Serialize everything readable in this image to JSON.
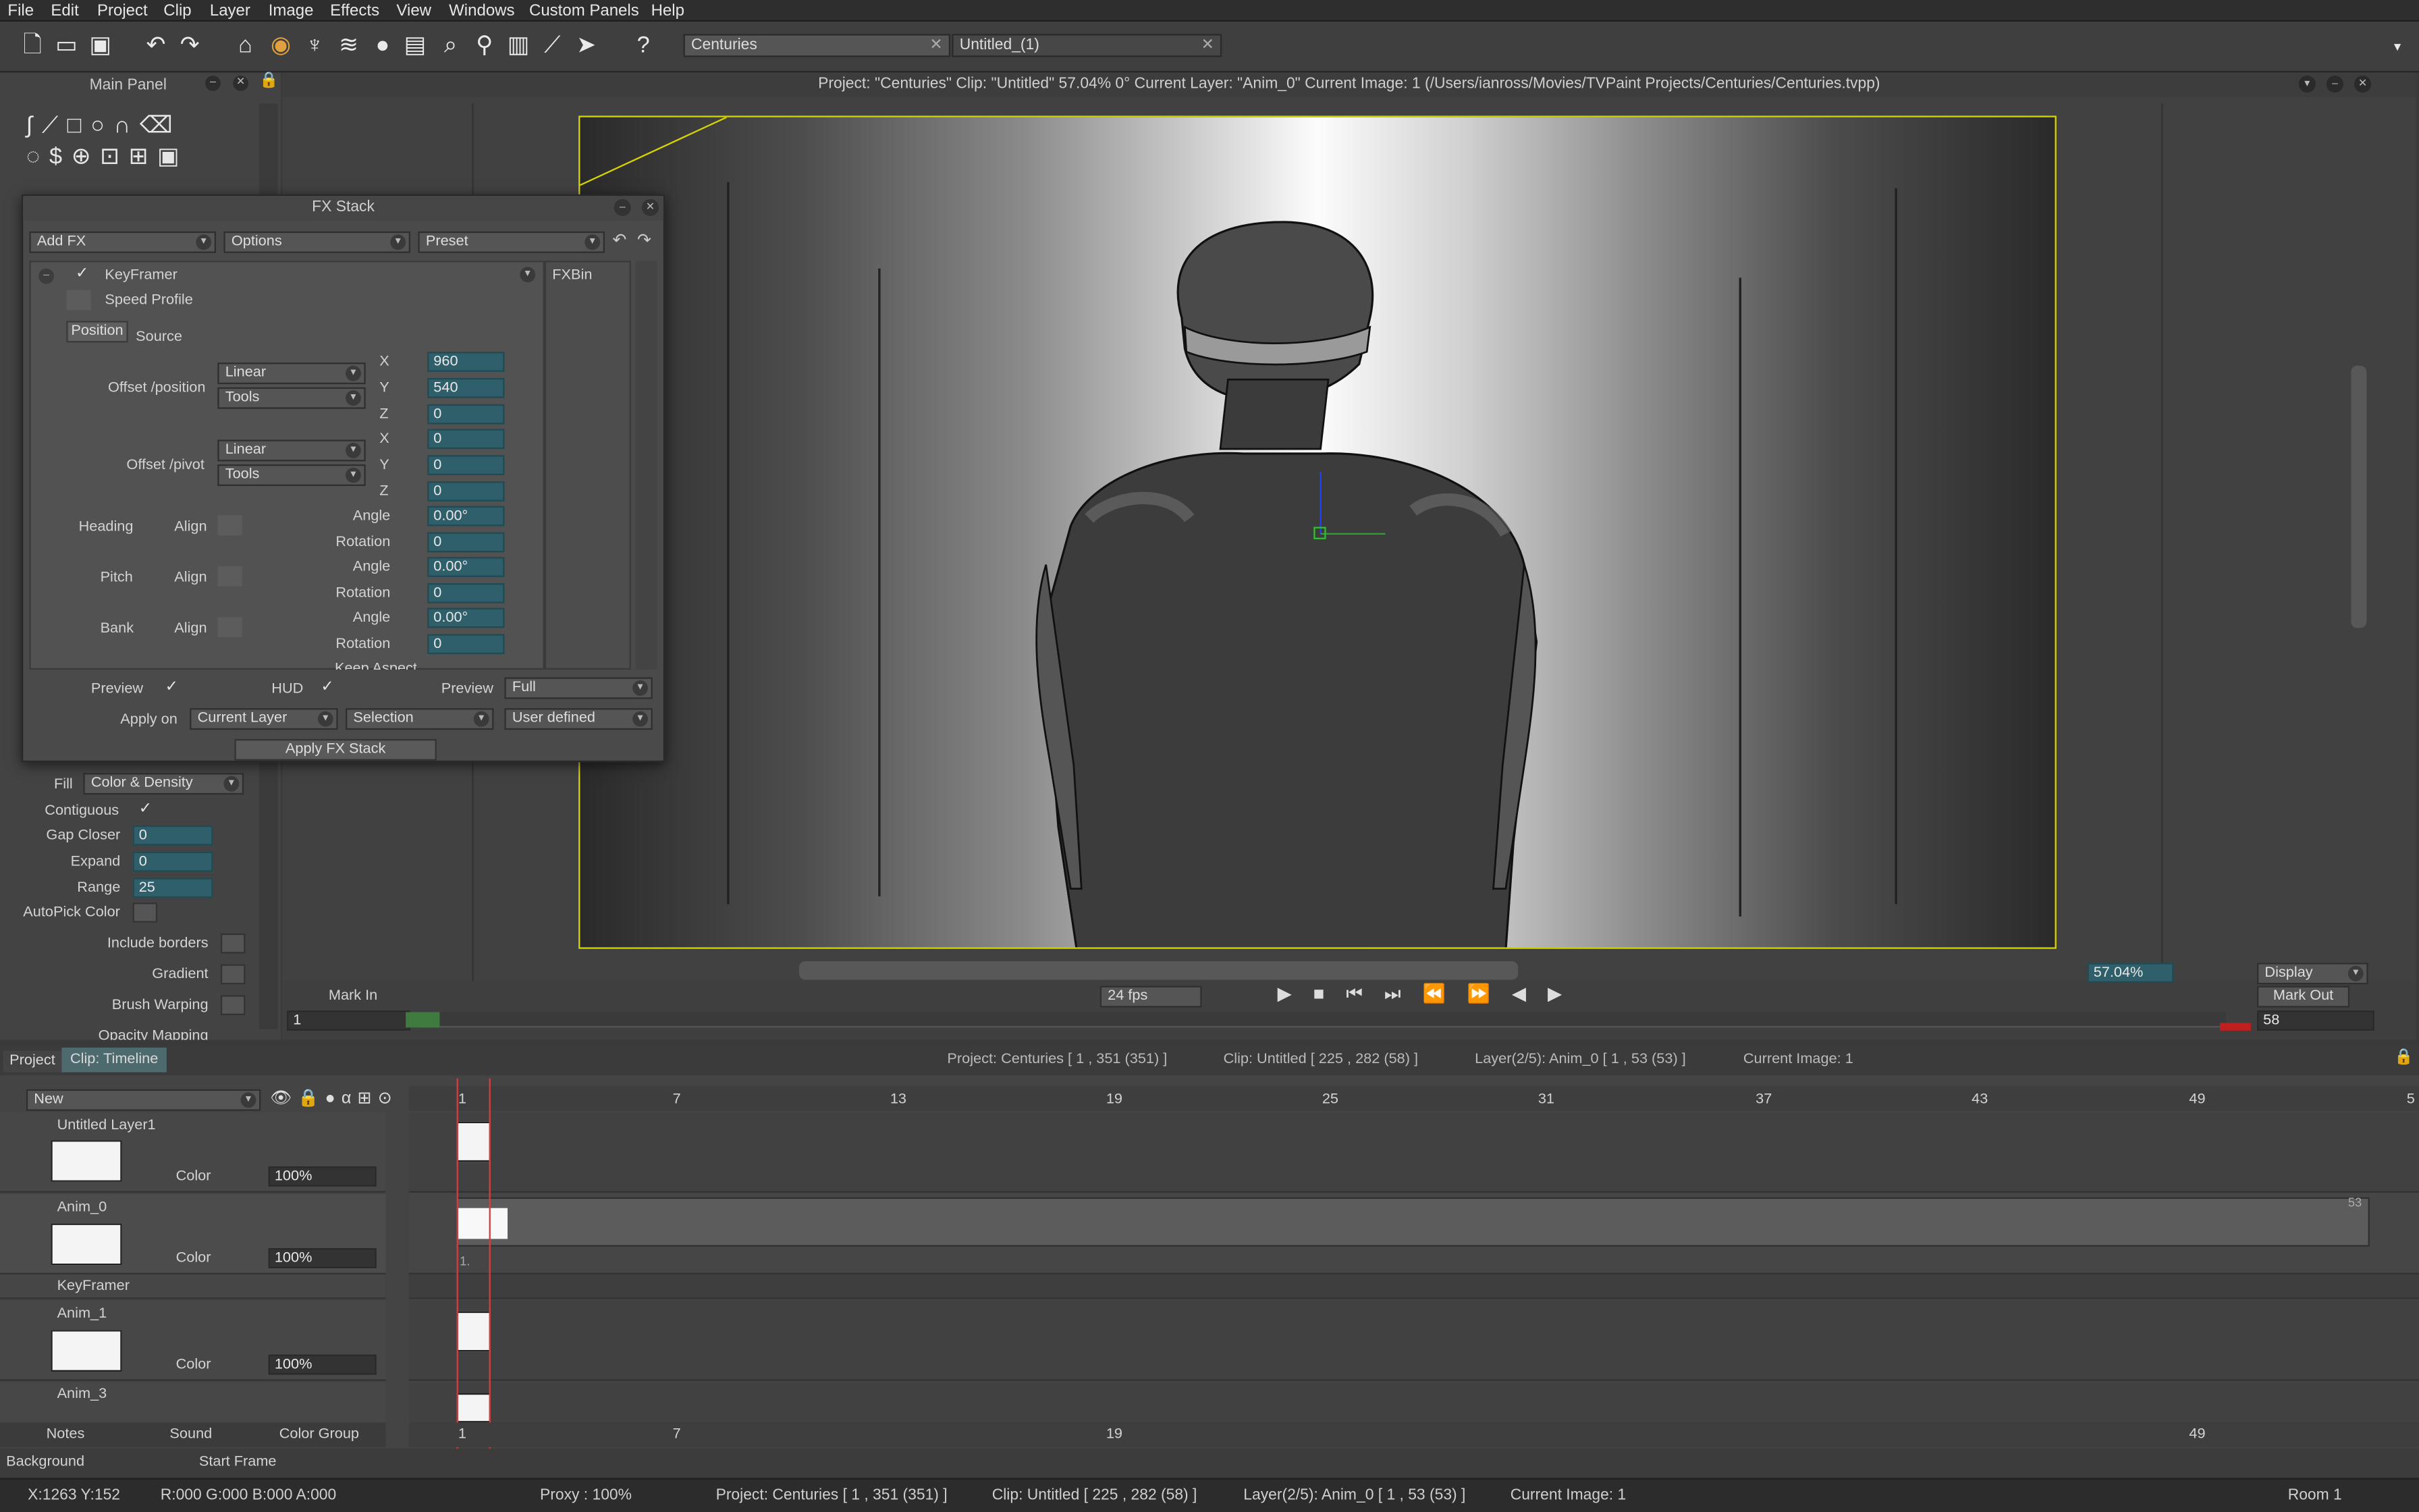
{
  "menu": [
    "File",
    "Edit",
    "Project",
    "Clip",
    "Layer",
    "Image",
    "Effects",
    "View",
    "Windows",
    "Custom Panels",
    "Help"
  ],
  "doc_tabs": [
    {
      "label": "Centuries"
    },
    {
      "label": "Untitled_(1)"
    }
  ],
  "main_panel": {
    "title": "Main Panel"
  },
  "viewer": {
    "title": "Project: \"Centuries\" Clip: \"Untitled\" 57.04%  0°  Current Layer: \"Anim_0\"  Current Image: 1 (/Users/ianross/Movies/TVPaint Projects/Centuries/Centuries.tvpp)"
  },
  "fx": {
    "title": "FX Stack",
    "add_fx": "Add FX",
    "options": "Options",
    "preset": "Preset",
    "effect": "KeyFramer",
    "speed_profile": "Speed Profile",
    "fxbin": "FXBin",
    "tab_position": "Position",
    "tab_source": "Source",
    "offset_position": "Offset /position",
    "offset_pivot": "Offset /pivot",
    "linear": "Linear",
    "tools": "Tools",
    "x": "X",
    "y": "Y",
    "z": "Z",
    "pos_x": "960",
    "pos_y": "540",
    "pos_z": "0",
    "piv_x": "0",
    "piv_y": "0",
    "piv_z": "0",
    "heading": "Heading",
    "pitch": "Pitch",
    "bank": "Bank",
    "align": "Align",
    "angle": "Angle",
    "rotation": "Rotation",
    "heading_angle": "0.00°",
    "heading_rotation": "0",
    "pitch_angle": "0.00°",
    "pitch_rotation": "0",
    "bank_angle": "0.00°",
    "bank_rotation": "0",
    "keep_aspect": "Keep Aspect",
    "preview": "Preview",
    "hud": "HUD",
    "preview2": "Preview",
    "preview_value": "Full",
    "apply_on": "Apply on",
    "current_layer": "Current Layer",
    "selection": "Selection",
    "user_defined": "User defined",
    "apply_button": "Apply FX Stack"
  },
  "fill": {
    "fill_label": "Fill",
    "fill_mode": "Color & Density",
    "contiguous": "Contiguous",
    "gap_closer": "Gap Closer",
    "gap_closer_val": "0",
    "expand": "Expand",
    "expand_val": "0",
    "range": "Range",
    "range_val": "25",
    "autopick": "AutoPick Color",
    "include_borders": "Include borders",
    "gradient": "Gradient",
    "brush_warping": "Brush Warping",
    "opacity_mapping": "Opacity Mapping"
  },
  "transport": {
    "mark_in": "Mark In",
    "mark_out": "Mark Out",
    "fps": "24 fps",
    "zoom": "57.04%",
    "display": "Display",
    "frame_start": "1",
    "frame_end": "58"
  },
  "timeline": {
    "tab_project": "Project",
    "tab_clip": "Clip: Timeline",
    "info_project": "Project: Centuries [ 1 , 351  (351) ]",
    "info_clip": "Clip: Untitled [ 225 , 282  (58) ]",
    "info_layer": "Layer(2/5): Anim_0 [ 1 , 53  (53) ]",
    "info_image": "Current Image: 1",
    "new": "New",
    "ruler": [
      "1",
      "7",
      "13",
      "19",
      "25",
      "31",
      "37",
      "43",
      "49",
      "5"
    ],
    "layers": [
      {
        "name": "Untitled Layer1",
        "mode": "Color",
        "opacity": "100%"
      },
      {
        "name": "Anim_0",
        "mode": "Color",
        "opacity": "100%"
      },
      {
        "name": "Anim_1",
        "mode": "Color",
        "opacity": "100%"
      },
      {
        "name": "Anim_3"
      }
    ],
    "keyframer": "KeyFramer",
    "anim0_end": "53",
    "one_dot": "1.",
    "bottom_tabs": [
      "Notes",
      "Sound",
      "Color Group"
    ],
    "background": "Background",
    "start_frame": "Start Frame"
  },
  "status": {
    "coords": "X:1263  Y:152",
    "rgba": "R:000 G:000 B:000 A:000",
    "proxy": "Proxy : 100%",
    "project": "Project: Centuries [ 1 , 351  (351) ]",
    "clip": "Clip: Untitled [ 225 , 282  (58) ]",
    "layer": "Layer(2/5): Anim_0 [ 1 , 53  (53) ]",
    "image": "Current Image: 1",
    "room": "Room 1"
  }
}
